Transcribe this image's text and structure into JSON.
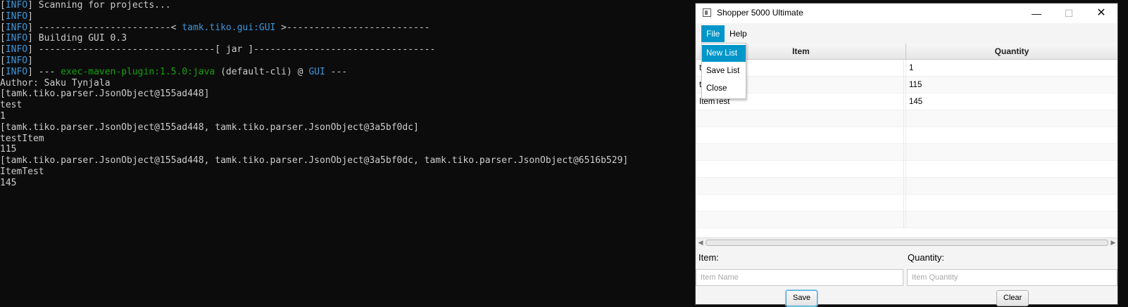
{
  "terminal": {
    "lines": [
      {
        "tag": "INFO",
        "text": " Scanning for projects..."
      },
      {
        "tag": "INFO",
        "text": ""
      },
      {
        "tag": "INFO",
        "text": " ------------------------< ",
        "highlight": "tamk.tiko.gui:GUI",
        "after": " >--------------------------"
      },
      {
        "tag": "INFO",
        "text": " Building GUI 0.3"
      },
      {
        "tag": "INFO",
        "text": " --------------------------------[ jar ]---------------------------------"
      },
      {
        "tag": "INFO",
        "text": ""
      },
      {
        "tag": "INFO",
        "text": " --- ",
        "plugin": "exec-maven-plugin:1.5.0:java",
        "after2": " (default-cli) @ ",
        "gui": "GUI",
        "after3": " ---"
      },
      {
        "text": "Author: Saku Tynjala"
      },
      {
        "text": "[tamk.tiko.parser.JsonObject@155ad448]"
      },
      {
        "text": "test"
      },
      {
        "text": "1"
      },
      {
        "text": "[tamk.tiko.parser.JsonObject@155ad448, tamk.tiko.parser.JsonObject@3a5bf0dc]"
      },
      {
        "text": "testItem"
      },
      {
        "text": "115"
      },
      {
        "text": "[tamk.tiko.parser.JsonObject@155ad448, tamk.tiko.parser.JsonObject@3a5bf0dc, tamk.tiko.parser.JsonObject@6516b529]"
      },
      {
        "text": "ItemTest"
      },
      {
        "text": "145"
      }
    ],
    "colors": {
      "background": "#0c0c0c",
      "text": "#cccccc",
      "info": "#3a96dd",
      "plugin": "#13a10e"
    }
  },
  "window": {
    "title": "Shopper 5000 Ultimate",
    "controls": {
      "minimize": "—",
      "maximize": "☐",
      "close": "✕"
    },
    "menu": {
      "file": "File",
      "help": "Help"
    },
    "dropdown": {
      "new_list": "New List",
      "save_list": "Save List",
      "close": "Close"
    },
    "table": {
      "headers": {
        "item": "Item",
        "quantity": "Quantity"
      },
      "rows": [
        {
          "item": "test",
          "quantity": "1"
        },
        {
          "item": "testItem",
          "quantity": "115"
        },
        {
          "item": "ItemTest",
          "quantity": "145"
        },
        {
          "item": "",
          "quantity": ""
        },
        {
          "item": "",
          "quantity": ""
        },
        {
          "item": "",
          "quantity": ""
        },
        {
          "item": "",
          "quantity": ""
        },
        {
          "item": "",
          "quantity": ""
        },
        {
          "item": "",
          "quantity": ""
        },
        {
          "item": "",
          "quantity": ""
        }
      ]
    },
    "form": {
      "item_label": "Item:",
      "quantity_label": "Quantity:",
      "item_placeholder": "Item Name",
      "quantity_placeholder": "Item Quantity",
      "save": "Save",
      "clear": "Clear"
    },
    "accent": "#0096c9"
  }
}
